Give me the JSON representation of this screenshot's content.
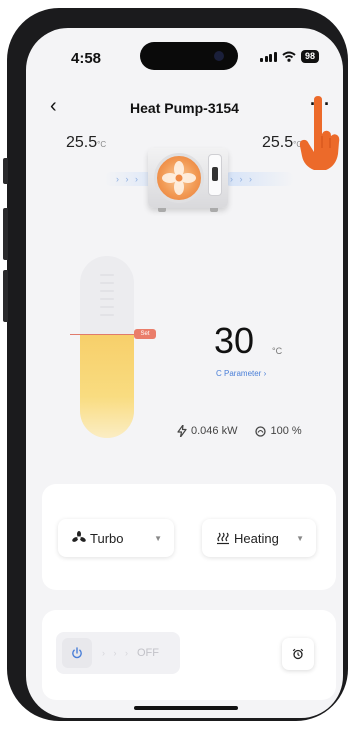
{
  "status_bar": {
    "time": "4:58",
    "battery": "98"
  },
  "nav": {
    "back_icon": "chevron-left-icon",
    "back_glyph": "‹",
    "title": "Heat Pump-3154",
    "more_glyph": "···"
  },
  "temperatures": {
    "left_value": "25.5",
    "left_unit": "°C",
    "right_value": "25.5",
    "right_unit": "°C"
  },
  "flow": {
    "left_arrows": "› › ›",
    "right_arrows": "› › ›"
  },
  "tank": {
    "fill_fraction": 0.57,
    "set_badge": "Set"
  },
  "setpoint": {
    "value": "30",
    "unit": "°C",
    "parameter_link": "C Parameter ›"
  },
  "stats": {
    "power": "0.046 kW",
    "percent": "100 %"
  },
  "controls": {
    "fan_mode": "Turbo",
    "mode": "Heating",
    "power_state": "OFF",
    "power_arrows": "› › ›"
  },
  "colors": {
    "accent_blue": "#4a7fd8",
    "set_red": "#ea7d6a",
    "tank_yellow": "#f7cf6a",
    "pointer_orange": "#ec6a2a"
  },
  "icons": [
    "chevron-left-icon",
    "more-icon",
    "fan-icon",
    "bolt-icon",
    "gauge-icon",
    "heating-icon",
    "power-icon",
    "alarm-clock-icon",
    "pointing-hand-icon"
  ]
}
